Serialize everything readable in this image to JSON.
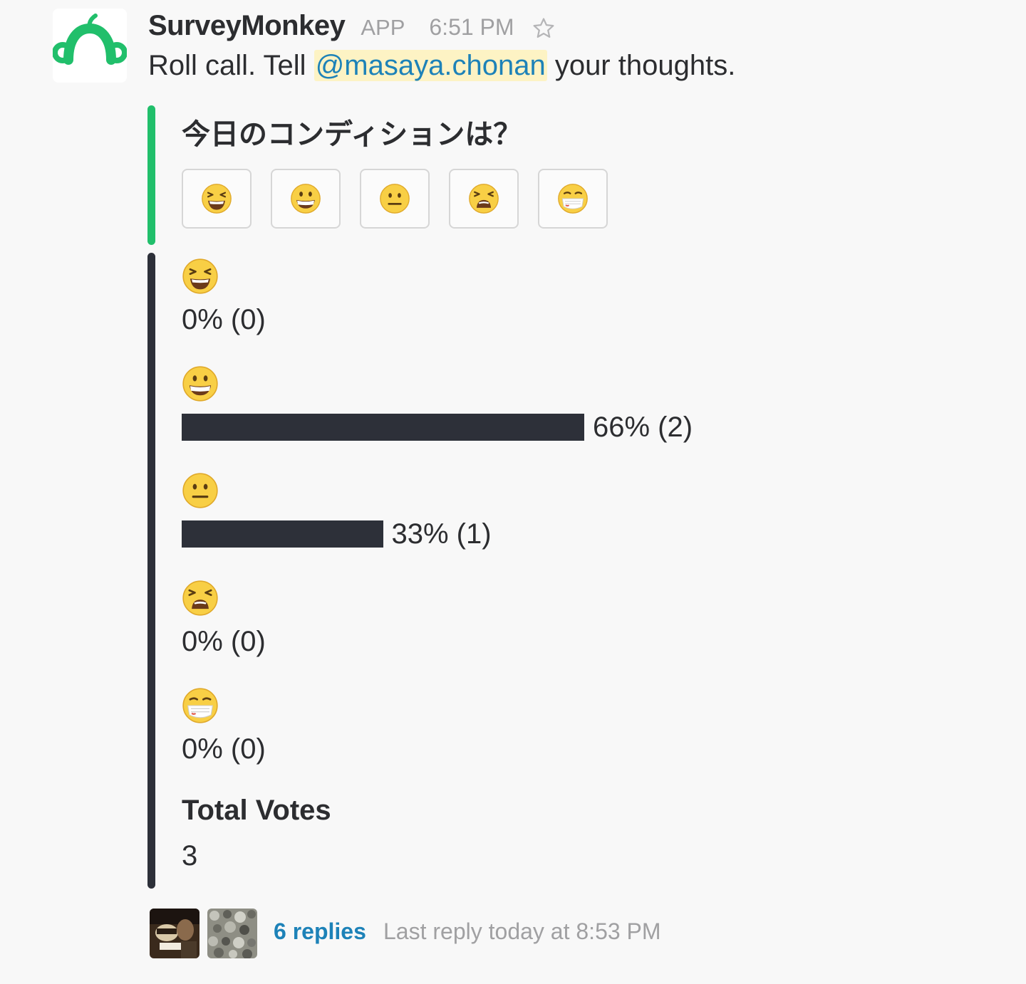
{
  "message": {
    "sender": "SurveyMonkey",
    "app_badge": "APP",
    "timestamp": "6:51 PM",
    "text_before": "Roll call. Tell ",
    "mention": "@masaya.chonan",
    "text_after": " your thoughts."
  },
  "poll": {
    "question": "今日のコンディションは？",
    "options": [
      {
        "icon": "laughing-face-icon"
      },
      {
        "icon": "grinning-face-icon"
      },
      {
        "icon": "neutral-face-icon"
      },
      {
        "icon": "weary-face-icon"
      },
      {
        "icon": "face-with-mask-icon"
      }
    ]
  },
  "results": [
    {
      "icon": "laughing-face-icon",
      "percent": 0,
      "label": "0% (0)"
    },
    {
      "icon": "grinning-face-icon",
      "percent": 66,
      "label": "66% (2)"
    },
    {
      "icon": "neutral-face-icon",
      "percent": 33,
      "label": "33% (1)"
    },
    {
      "icon": "weary-face-icon",
      "percent": 0,
      "label": "0% (0)"
    },
    {
      "icon": "face-with-mask-icon",
      "percent": 0,
      "label": "0% (0)"
    }
  ],
  "total": {
    "label": "Total Votes",
    "value": "3"
  },
  "thread": {
    "replies_label": "6 replies",
    "last_reply": "Last reply today at 8:53 PM"
  },
  "colors": {
    "brand_green": "#21bf6b",
    "result_bar": "#2d3039",
    "link_blue": "#1d82b8",
    "mention_bg": "#fdf3c4"
  }
}
